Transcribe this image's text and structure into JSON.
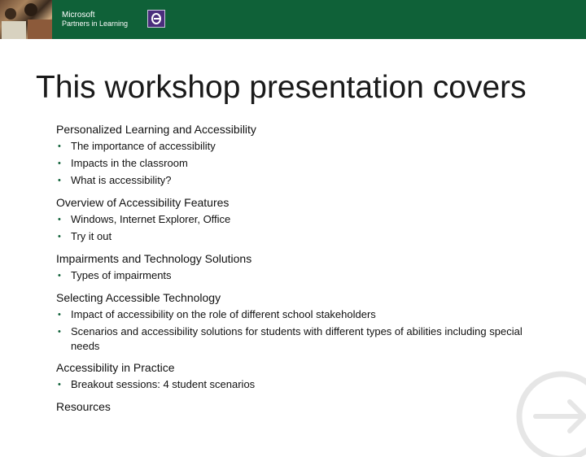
{
  "header": {
    "brand_line1": "Microsoft",
    "brand_line2": "Partners in Learning"
  },
  "slide": {
    "title": "This workshop presentation covers",
    "sections": [
      {
        "heading": "Personalized Learning and Accessibility",
        "bullets": [
          "The importance of accessibility",
          "Impacts in the classroom",
          "What is accessibility?"
        ]
      },
      {
        "heading": "Overview of Accessibility Features",
        "bullets": [
          "Windows, Internet Explorer, Office",
          "Try it out"
        ]
      },
      {
        "heading": "Impairments and Technology Solutions",
        "bullets": [
          "Types of impairments"
        ]
      },
      {
        "heading": "Selecting Accessible Technology",
        "bullets": [
          "Impact of accessibility on the role of different school stakeholders",
          "Scenarios and accessibility solutions for students with different types of abilities including special needs"
        ]
      },
      {
        "heading": "Accessibility in Practice",
        "bullets": [
          "Breakout sessions: 4 student scenarios"
        ]
      },
      {
        "heading": "Resources",
        "bullets": []
      }
    ]
  },
  "colors": {
    "header_green": "#0f6138",
    "logo_purple": "#4a2d7c",
    "deco_gray": "#e6e6e6"
  },
  "icons": {
    "logo": "partners-in-learning-logo-icon",
    "deco": "arrow-circle-icon"
  }
}
